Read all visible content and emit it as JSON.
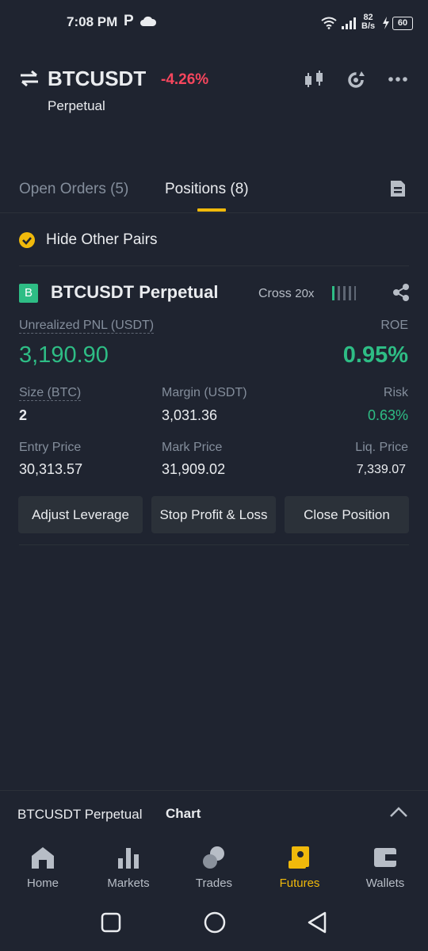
{
  "status_bar": {
    "time": "7:08 PM",
    "p_glyph": "P",
    "speed_value": "82",
    "speed_unit": "B/s",
    "battery": "60"
  },
  "header": {
    "symbol": "BTCUSDT",
    "change": "-4.26%",
    "contract": "Perpetual"
  },
  "tabs": {
    "open_orders": "Open Orders",
    "open_orders_count": "(5)",
    "positions": "Positions",
    "positions_count": "(8)"
  },
  "filter": {
    "hide_other_pairs": "Hide Other Pairs"
  },
  "position": {
    "badge": "B",
    "title": "BTCUSDT Perpetual",
    "margin_mode": "Cross",
    "leverage": "20x",
    "unrealized_pnl_label": "Unrealized PNL (USDT)",
    "unrealized_pnl": "3,190.90",
    "roe_label": "ROE",
    "roe": "0.95%",
    "size_label": "Size (BTC)",
    "size": "2",
    "margin_label": "Margin (USDT)",
    "margin": "3,031.36",
    "risk_label": "Risk",
    "risk": "0.63%",
    "entry_label": "Entry Price",
    "entry": "30,313.57",
    "mark_label": "Mark Price",
    "mark": "31,909.02",
    "liq_label": "Liq. Price",
    "liq": "7,339.07"
  },
  "actions": {
    "adjust_leverage": "Adjust Leverage",
    "stop_profit_loss": "Stop Profit & Loss",
    "close_position": "Close Position"
  },
  "chart_bar": {
    "symbol": "BTCUSDT Perpetual",
    "label": "Chart"
  },
  "nav": {
    "home": "Home",
    "markets": "Markets",
    "trades": "Trades",
    "futures": "Futures",
    "wallets": "Wallets"
  },
  "colors": {
    "background": "#1f2430",
    "accent": "#f0b90b",
    "positive": "#2ebd85",
    "negative": "#f6465d"
  }
}
